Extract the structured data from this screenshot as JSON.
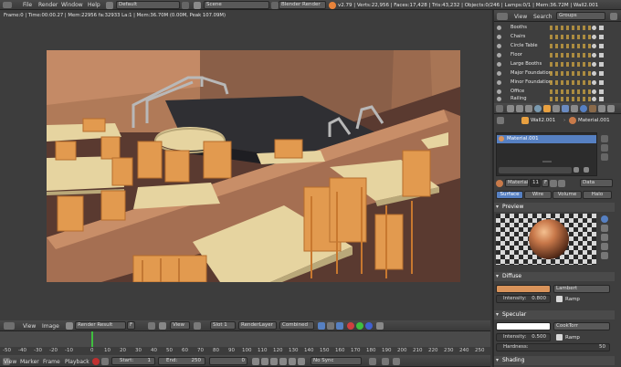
{
  "info_header": {
    "menus": [
      "File",
      "Render",
      "Window",
      "Help"
    ],
    "screen_layout": "Default",
    "scene": "Scene",
    "engine": "Blender Render",
    "stats": "v2.79 | Verts:22,956 | Faces:17,428 | Tris:43,232 | Objects:0/246 | Lamps:0/1 | Mem:36.72M | Wall2.001"
  },
  "image_editor": {
    "render_info": "Frame:0 | Time:00:00.27 | Mem:22956 fa:32933 La:1 | Mem:36.70M (0.00M, Peak 107.09M)",
    "header": {
      "view": "View",
      "image": "Image",
      "image_name": "Render Result",
      "f_button": "F",
      "view_label": "View",
      "slot": "Slot 1",
      "render_layer": "RenderLayer",
      "pass": "Combined"
    }
  },
  "timeline": {
    "ticks": [
      "-50",
      "-40",
      "-30",
      "-20",
      "-10",
      "0",
      "10",
      "20",
      "30",
      "40",
      "50",
      "60",
      "70",
      "80",
      "90",
      "100",
      "110",
      "120",
      "130",
      "140",
      "150",
      "160",
      "170",
      "180",
      "190",
      "200",
      "210",
      "220",
      "230",
      "240",
      "250"
    ],
    "menus": [
      "View",
      "Marker",
      "Frame",
      "Playback"
    ],
    "start_label": "Start:",
    "start_value": "1",
    "end_label": "End:",
    "end_value": "250",
    "current_frame": "0",
    "sync": "No Sync"
  },
  "outliner": {
    "menus": [
      "View",
      "Search"
    ],
    "display_mode": "Groups",
    "items": [
      "Booths",
      "Chairs",
      "Circle Table",
      "Floor",
      "Large Booths",
      "Major Foundation",
      "Minor Foundation",
      "Office",
      "Railing"
    ]
  },
  "properties": {
    "breadcrumb_object": "Wall2.001",
    "breadcrumb_material": "Material.001",
    "material_slot": "Material.001",
    "datablock_name": "Material",
    "user_count": "11",
    "f_button": "F",
    "link_value": "Data",
    "type_tabs": [
      "Surface",
      "Wire",
      "Volume",
      "Halo"
    ],
    "active_type_tab": "Surface",
    "preview_title": "Preview",
    "diffuse": {
      "title": "Diffuse",
      "color": "#d9935a",
      "shader": "Lambert",
      "intensity_label": "Intensity:",
      "intensity_value": "0.800",
      "ramp_label": "Ramp"
    },
    "specular": {
      "title": "Specular",
      "color": "#ffffff",
      "shader": "CookTorr",
      "intensity_label": "Intensity:",
      "intensity_value": "0.500",
      "ramp_label": "Ramp",
      "hardness_label": "Hardness:",
      "hardness_value": "50"
    },
    "shading_title": "Shading"
  },
  "colors": {
    "selected_blue": "#5680c2",
    "active_frame_green": "#3fbf3f"
  }
}
